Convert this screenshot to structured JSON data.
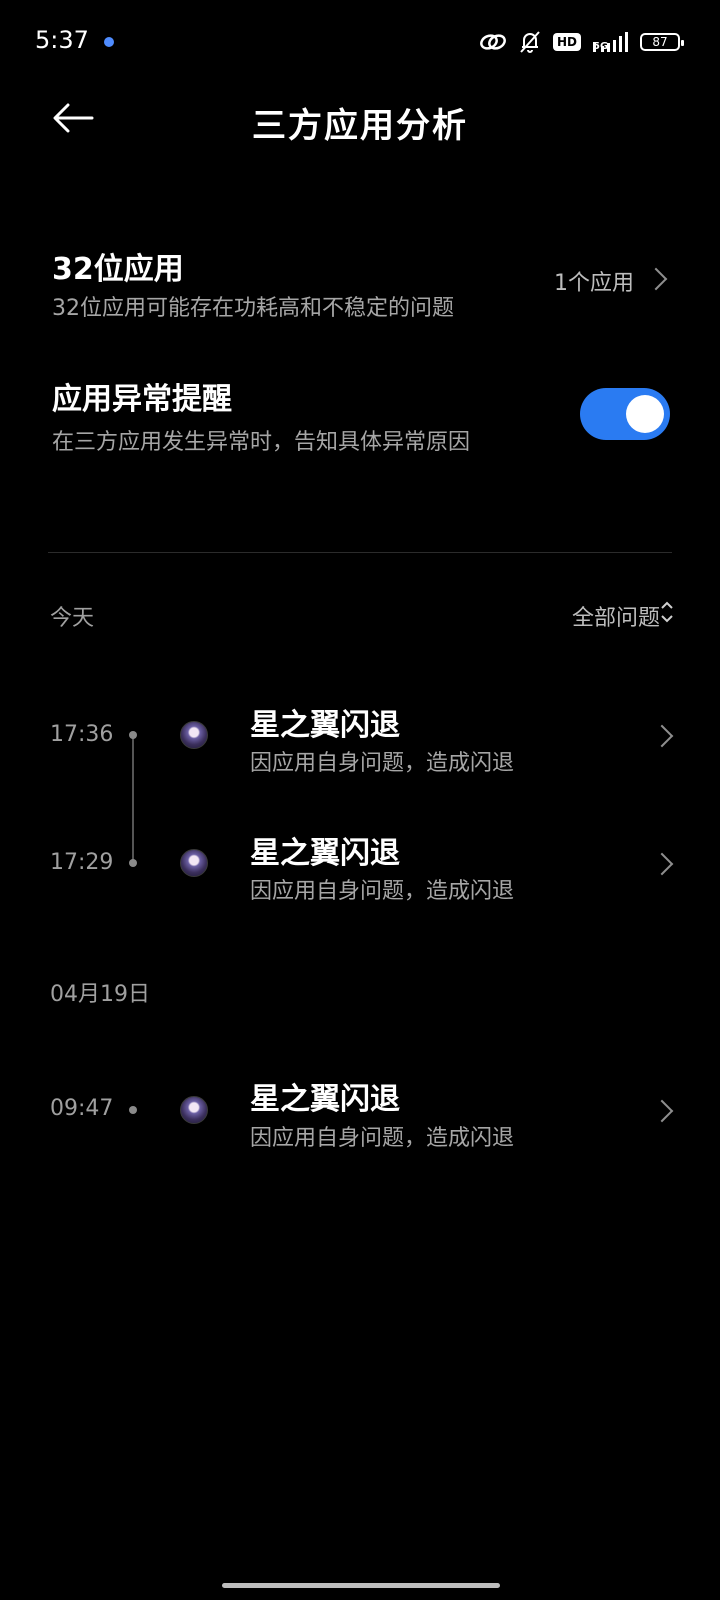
{
  "status_bar": {
    "time": "5:37",
    "network": "5G",
    "hd": "HD",
    "battery": "87"
  },
  "header": {
    "title": "三方应用分析"
  },
  "settings": {
    "apps32": {
      "title": "32位应用",
      "description": "32位应用可能存在功耗高和不稳定的问题",
      "value": "1个应用"
    },
    "anomaly_alert": {
      "title": "应用异常提醒",
      "description": "在三方应用发生异常时，告知具体异常原因",
      "enabled": true,
      "toggle_color": "#2a7bf2"
    }
  },
  "history": {
    "filter_label": "全部问题",
    "groups": [
      {
        "date": "今天",
        "items": [
          {
            "time": "17:36",
            "title": "星之翼闪退",
            "description": "因应用自身问题，造成闪退"
          },
          {
            "time": "17:29",
            "title": "星之翼闪退",
            "description": "因应用自身问题，造成闪退"
          }
        ]
      },
      {
        "date": "04月19日",
        "items": [
          {
            "time": "09:47",
            "title": "星之翼闪退",
            "description": "因应用自身问题，造成闪退"
          }
        ]
      }
    ]
  }
}
